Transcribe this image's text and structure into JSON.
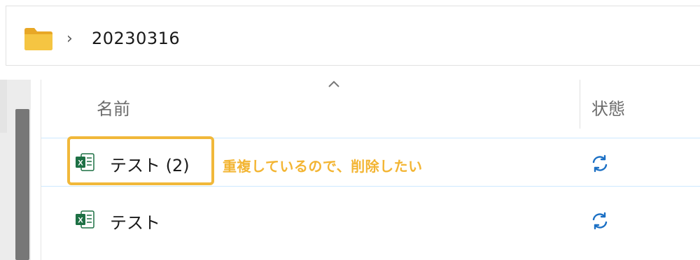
{
  "address_bar": {
    "folder_icon": "folder-icon",
    "separator": "›",
    "path": "20230316"
  },
  "column_header": {
    "name": "名前",
    "status": "状態",
    "sort_indicator": "sort-ascending-caret-icon"
  },
  "files": [
    {
      "name": "テスト (2)",
      "icon": "excel-file-icon",
      "status_icon": "sync-icon",
      "highlighted": true
    },
    {
      "name": "テスト",
      "icon": "excel-file-icon",
      "status_icon": "sync-icon",
      "highlighted": false
    }
  ],
  "annotation": {
    "text": "重複しているので、削除したい",
    "color": "#f3b533"
  },
  "colors": {
    "highlight_border": "#f1b83a",
    "sync_icon": "#1a6fc4",
    "excel_green": "#1d7044",
    "folder_yellow": "#f5c542",
    "row_selection_border": "#cce8ff"
  }
}
